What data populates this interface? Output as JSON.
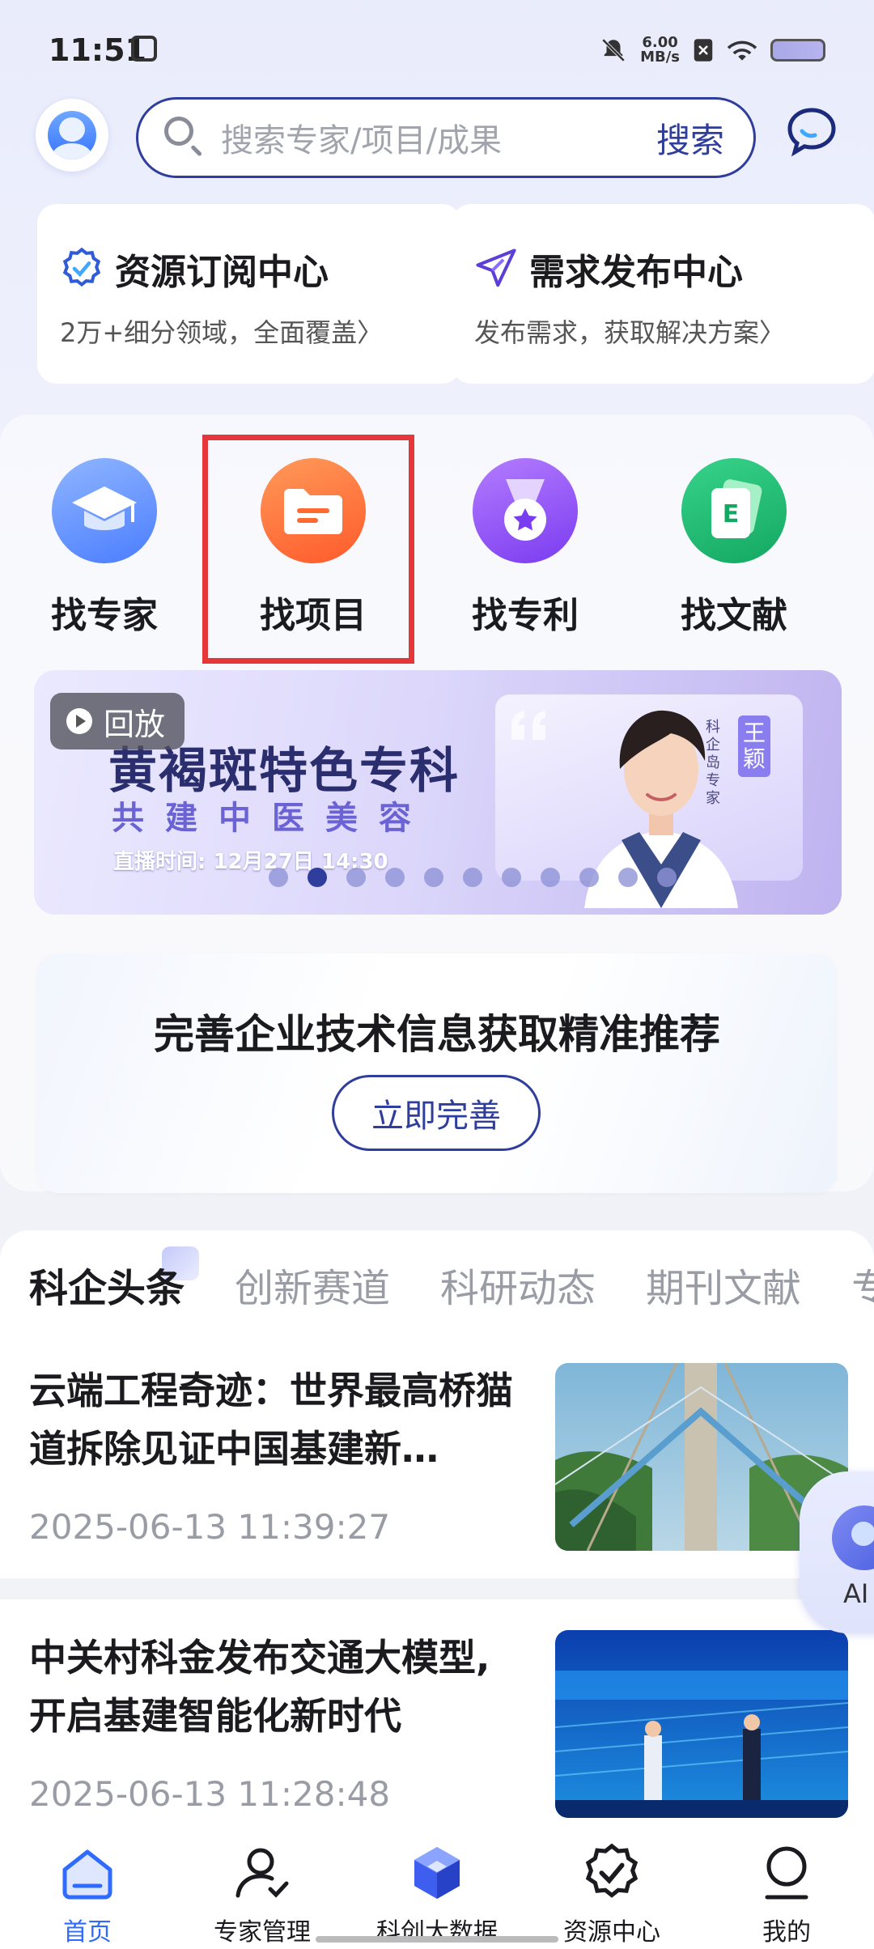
{
  "status_bar": {
    "time": "11:51",
    "net_speed_value": "6.00",
    "net_speed_unit": "MB/s"
  },
  "header": {
    "search_placeholder": "搜索专家/项目/成果",
    "search_button": "搜索"
  },
  "top_cards": [
    {
      "title": "资源订阅中心",
      "subtitle": "2万+细分领域，全面覆盖〉"
    },
    {
      "title": "需求发布中心",
      "subtitle": "发布需求，获取解决方案〉"
    }
  ],
  "quick_actions": [
    {
      "label": "找专家",
      "icon": "graduation-cap-icon"
    },
    {
      "label": "找项目",
      "icon": "folder-icon"
    },
    {
      "label": "找专利",
      "icon": "medal-icon"
    },
    {
      "label": "找文献",
      "icon": "document-e-icon"
    }
  ],
  "banner": {
    "badge": "回放",
    "title": "黄褐斑特色专科",
    "subtitle": "共建中医美容",
    "time_text": "直播时间: 12月27日 14:30",
    "expert_tag": "科企岛专家",
    "expert_name": "王颖",
    "slide_count": 11,
    "active_slide": 2
  },
  "promo": {
    "title": "完善企业技术信息获取精准推荐",
    "button": "立即完善"
  },
  "news_tabs": [
    "科企头条",
    "创新赛道",
    "科研动态",
    "期刊文献",
    "专"
  ],
  "news": [
    {
      "title": "云端工程奇迹：世界最高桥猫道拆除见证中国基建新…",
      "time": "2025-06-13 11:39:27"
    },
    {
      "title": "中关村科金发布交通大模型,开启基建智能化新时代",
      "time": "2025-06-13 11:28:48"
    }
  ],
  "ai_label": "AI",
  "bottom_nav": [
    {
      "label": "首页",
      "icon": "home-icon",
      "active": true
    },
    {
      "label": "专家管理",
      "icon": "user-check-icon",
      "active": false
    },
    {
      "label": "科创大数据",
      "icon": "cube-icon",
      "active": false
    },
    {
      "label": "资源中心",
      "icon": "badge-check-icon",
      "active": false
    },
    {
      "label": "我的",
      "icon": "profile-icon",
      "active": false
    }
  ],
  "colors": {
    "brand": "#2f3e9c",
    "highlight": "#e5373a",
    "active_nav": "#2f6bff"
  }
}
